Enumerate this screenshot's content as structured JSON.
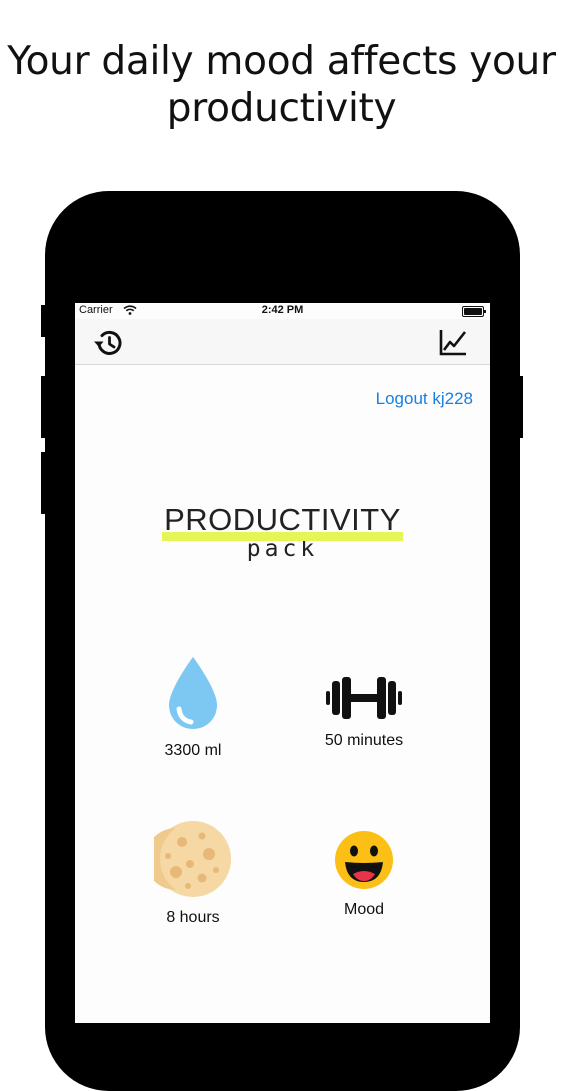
{
  "headline": {
    "line1": "Your daily mood affects your",
    "line2": "productivity"
  },
  "status_bar": {
    "carrier": "Carrier",
    "time": "2:42 PM"
  },
  "nav": {
    "left_icon": "history-icon",
    "right_icon": "chart-icon"
  },
  "account": {
    "logout_label": "Logout kj228"
  },
  "brand": {
    "title": "PRODUCTIVITY",
    "subtitle": "pack",
    "underline_color": "#e5f456"
  },
  "trackers": [
    {
      "icon": "water-drop-icon",
      "label": "3300 ml"
    },
    {
      "icon": "dumbbell-icon",
      "label": "50 minutes"
    },
    {
      "icon": "moon-icon",
      "label": "8 hours"
    },
    {
      "icon": "smiley-icon",
      "label": "Mood"
    }
  ],
  "colors": {
    "link": "#1a7fe0",
    "drop": "#7cc8f2",
    "moon": "#f5d8a3",
    "smiley": "#fcbf16"
  }
}
